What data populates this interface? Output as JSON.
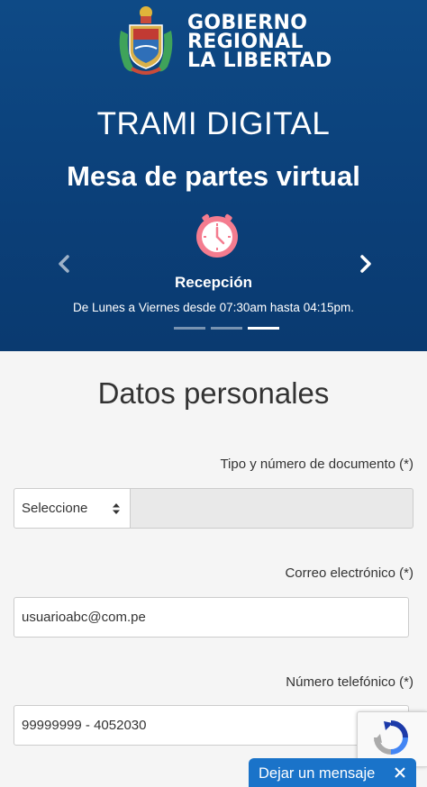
{
  "header": {
    "logo_line1": "GOBIERNO",
    "logo_line2": "REGIONAL",
    "logo_line3": "LA LIBERTAD",
    "title": "TRAMI DIGITAL",
    "subtitle": "Mesa de partes virtual"
  },
  "carousel": {
    "icon": "clock-icon",
    "slide_title": "Recepción",
    "slide_description": "De Lunes a Viernes desde 07:30am hasta 04:15pm.",
    "active_index": 3,
    "total": 3
  },
  "form": {
    "section_title": "Datos personales",
    "document_label": "Tipo y número de documento (*)",
    "document_type_value": "Seleccione",
    "document_number_value": "",
    "email_label": "Correo electrónico (*)",
    "email_value": "usuarioabc@com.pe",
    "phone_label": "Número telefónico (*)",
    "phone_value": "99999999 - 4052030"
  },
  "chat_widget": {
    "label": "Dejar un mensaje"
  },
  "colors": {
    "hero_bg": "#0b3f78",
    "chat_bg": "#1a73c9",
    "clock_pink": "#f47c8f"
  }
}
